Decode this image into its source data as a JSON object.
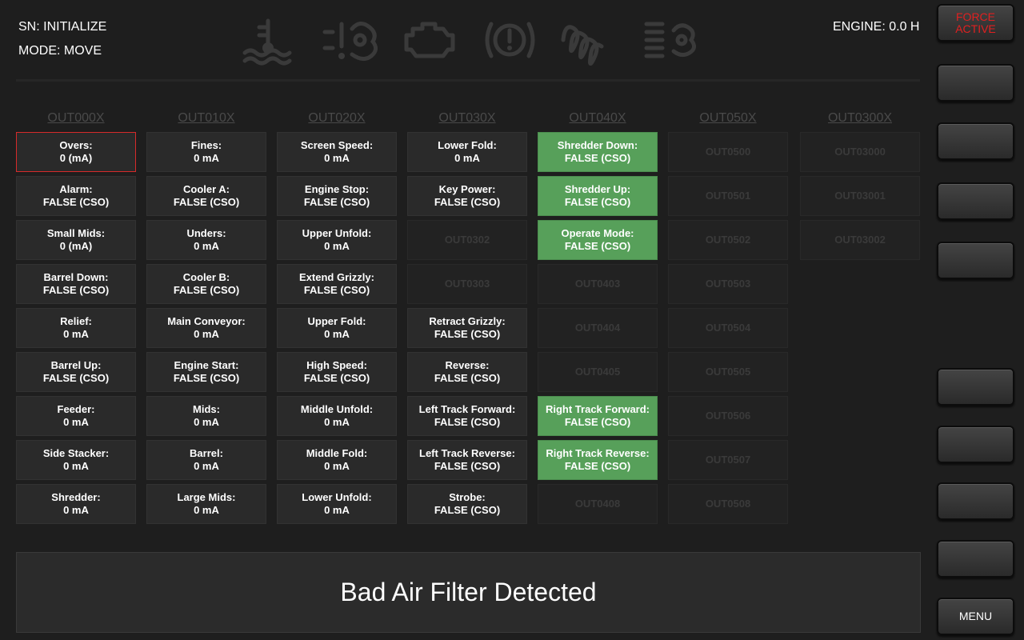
{
  "header": {
    "sn": "SN: INITIALIZE",
    "mode": "MODE: MOVE",
    "engine": "ENGINE: 0.0 H",
    "indicator_icons": [
      "coolant-temp-icon",
      "warning-exhaust-icon",
      "check-engine-icon",
      "warning-light-icon",
      "glow-plug-icon",
      "air-filter-icon"
    ],
    "indicator_color": "#3a3a3a"
  },
  "columns": [
    {
      "header": "OUT000X",
      "cells": [
        {
          "label": "Overs:",
          "value": "0 (mA)",
          "state": "selected"
        },
        {
          "label": "Alarm:",
          "value": "FALSE (CSO)",
          "state": "normal"
        },
        {
          "label": "Small Mids:",
          "value": "0 (mA)",
          "state": "normal"
        },
        {
          "label": "Barrel Down:",
          "value": "FALSE (CSO)",
          "state": "normal"
        },
        {
          "label": "Relief:",
          "value": "0 mA",
          "state": "normal"
        },
        {
          "label": "Barrel Up:",
          "value": "FALSE (CSO)",
          "state": "normal"
        },
        {
          "label": "Feeder:",
          "value": "0 mA",
          "state": "normal"
        },
        {
          "label": "Side Stacker:",
          "value": "0 mA",
          "state": "normal"
        },
        {
          "label": "Shredder:",
          "value": "0 mA",
          "state": "normal"
        }
      ]
    },
    {
      "header": "OUT010X",
      "cells": [
        {
          "label": "Fines:",
          "value": "0 mA",
          "state": "normal"
        },
        {
          "label": "Cooler A:",
          "value": "FALSE (CSO)",
          "state": "normal"
        },
        {
          "label": "Unders:",
          "value": "0 mA",
          "state": "normal"
        },
        {
          "label": "Cooler B:",
          "value": "FALSE (CSO)",
          "state": "normal"
        },
        {
          "label": "Main Conveyor:",
          "value": "0 mA",
          "state": "normal"
        },
        {
          "label": "Engine Start:",
          "value": "FALSE (CSO)",
          "state": "normal"
        },
        {
          "label": "Mids:",
          "value": "0 mA",
          "state": "normal"
        },
        {
          "label": "Barrel:",
          "value": "0 mA",
          "state": "normal"
        },
        {
          "label": "Large Mids:",
          "value": "0 mA",
          "state": "normal"
        }
      ]
    },
    {
      "header": "OUT020X",
      "cells": [
        {
          "label": "Screen Speed:",
          "value": "0 mA",
          "state": "normal"
        },
        {
          "label": "Engine Stop:",
          "value": "FALSE (CSO)",
          "state": "normal"
        },
        {
          "label": "Upper Unfold:",
          "value": "0 mA",
          "state": "normal"
        },
        {
          "label": "Extend Grizzly:",
          "value": "FALSE (CSO)",
          "state": "normal"
        },
        {
          "label": "Upper Fold:",
          "value": "0 mA",
          "state": "normal"
        },
        {
          "label": "High Speed:",
          "value": "FALSE (CSO)",
          "state": "normal"
        },
        {
          "label": "Middle Unfold:",
          "value": "0 mA",
          "state": "normal"
        },
        {
          "label": "Middle Fold:",
          "value": "0 mA",
          "state": "normal"
        },
        {
          "label": "Lower Unfold:",
          "value": "0 mA",
          "state": "normal"
        }
      ]
    },
    {
      "header": "OUT030X",
      "cells": [
        {
          "label": "Lower Fold:",
          "value": "0 mA",
          "state": "normal"
        },
        {
          "label": "Key Power:",
          "value": "FALSE (CSO)",
          "state": "normal"
        },
        {
          "label": "OUT0302",
          "value": "",
          "state": "empty"
        },
        {
          "label": "OUT0303",
          "value": "",
          "state": "empty"
        },
        {
          "label": "Retract Grizzly:",
          "value": "FALSE (CSO)",
          "state": "normal"
        },
        {
          "label": "Reverse:",
          "value": "FALSE (CSO)",
          "state": "normal"
        },
        {
          "label": "Left Track Forward:",
          "value": "FALSE (CSO)",
          "state": "normal"
        },
        {
          "label": "Left Track Reverse:",
          "value": "FALSE (CSO)",
          "state": "normal"
        },
        {
          "label": "Strobe:",
          "value": "FALSE (CSO)",
          "state": "normal"
        }
      ]
    },
    {
      "header": "OUT040X",
      "cells": [
        {
          "label": "Shredder Down:",
          "value": "FALSE (CSO)",
          "state": "active"
        },
        {
          "label": "Shredder Up:",
          "value": "FALSE (CSO)",
          "state": "active"
        },
        {
          "label": "Operate Mode:",
          "value": "FALSE (CSO)",
          "state": "active"
        },
        {
          "label": "OUT0403",
          "value": "",
          "state": "empty"
        },
        {
          "label": "OUT0404",
          "value": "",
          "state": "empty"
        },
        {
          "label": "OUT0405",
          "value": "",
          "state": "empty"
        },
        {
          "label": "Right Track Forward:",
          "value": "FALSE (CSO)",
          "state": "active"
        },
        {
          "label": "Right Track Reverse:",
          "value": "FALSE (CSO)",
          "state": "active"
        },
        {
          "label": "OUT0408",
          "value": "",
          "state": "empty"
        }
      ]
    },
    {
      "header": "OUT050X",
      "cells": [
        {
          "label": "OUT0500",
          "value": "",
          "state": "empty"
        },
        {
          "label": "OUT0501",
          "value": "",
          "state": "empty"
        },
        {
          "label": "OUT0502",
          "value": "",
          "state": "empty"
        },
        {
          "label": "OUT0503",
          "value": "",
          "state": "empty"
        },
        {
          "label": "OUT0504",
          "value": "",
          "state": "empty"
        },
        {
          "label": "OUT0505",
          "value": "",
          "state": "empty"
        },
        {
          "label": "OUT0506",
          "value": "",
          "state": "empty"
        },
        {
          "label": "OUT0507",
          "value": "",
          "state": "empty"
        },
        {
          "label": "OUT0508",
          "value": "",
          "state": "empty"
        }
      ]
    },
    {
      "header": "OUT0300X",
      "cells": [
        {
          "label": "OUT03000",
          "value": "",
          "state": "empty"
        },
        {
          "label": "OUT03001",
          "value": "",
          "state": "empty"
        },
        {
          "label": "OUT03002",
          "value": "",
          "state": "empty"
        }
      ]
    }
  ],
  "message": "Bad Air Filter Detected",
  "side_buttons": [
    {
      "lines": [
        "FORCE",
        "ACTIVE"
      ],
      "style": "force",
      "name": "force-active-button"
    },
    {
      "lines": [],
      "style": "blank",
      "name": "side-button-2"
    },
    {
      "lines": [],
      "style": "blank",
      "name": "side-button-3"
    },
    {
      "lines": [],
      "style": "blank",
      "name": "side-button-4"
    },
    {
      "lines": [],
      "style": "blank",
      "name": "side-button-5"
    },
    {
      "lines": [],
      "style": "blank",
      "name": "side-button-6"
    },
    {
      "lines": [],
      "style": "blank",
      "name": "side-button-7"
    },
    {
      "lines": [],
      "style": "blank",
      "name": "side-button-8"
    },
    {
      "lines": [],
      "style": "blank",
      "name": "side-button-9"
    },
    {
      "lines": [
        "MENU"
      ],
      "style": "menu",
      "name": "menu-button"
    }
  ],
  "colors": {
    "background": "#1e1e1e",
    "active_cell": "#57a05a",
    "selected_border": "#d62a2a",
    "force_text": "#e02020"
  }
}
